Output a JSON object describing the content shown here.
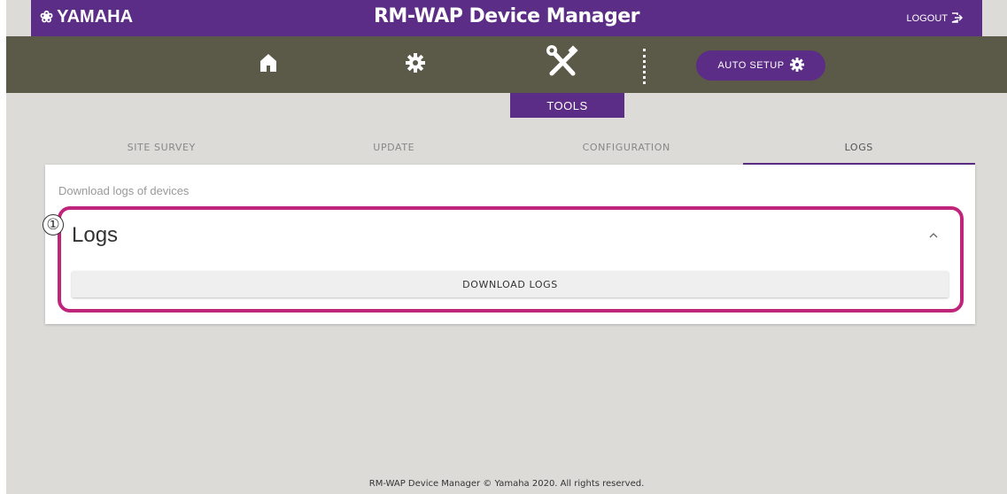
{
  "header": {
    "logo_text": "YAMAHA",
    "title": "RM-WAP Device Manager",
    "logout_label": "LOGOUT"
  },
  "nav": {
    "icons": [
      "home-icon",
      "gear-icon",
      "tools-icon"
    ],
    "active_label": "TOOLS",
    "auto_setup_label": "AUTO SETUP"
  },
  "tabs": [
    {
      "label": "SITE SURVEY",
      "active": false
    },
    {
      "label": "UPDATE",
      "active": false
    },
    {
      "label": "CONFIGURATION",
      "active": false
    },
    {
      "label": "LOGS",
      "active": true
    }
  ],
  "panel": {
    "description": "Download logs of devices",
    "section_title": "Logs",
    "download_button_label": "DOWNLOAD LOGS",
    "callout_number": "①"
  },
  "footer": {
    "text": "RM-WAP Device Manager © Yamaha 2020. All rights reserved."
  },
  "colors": {
    "accent": "#5c2d86",
    "navbar": "#5b5947",
    "callout": "#c0257c",
    "background": "#dddbd8"
  }
}
